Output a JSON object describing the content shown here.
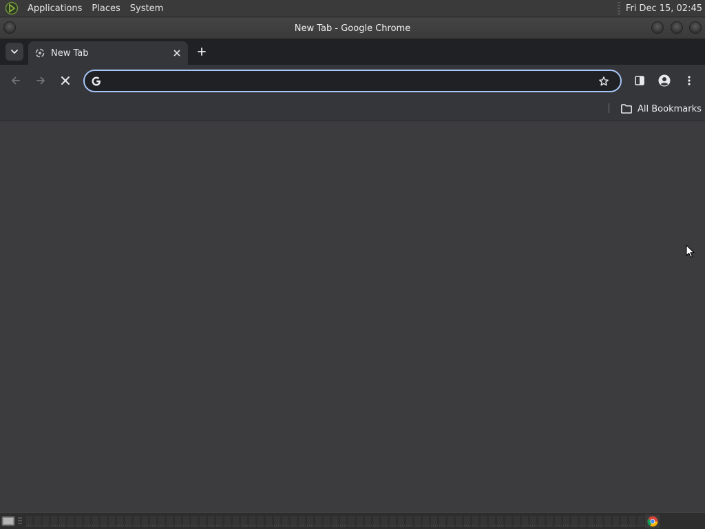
{
  "top_panel": {
    "menus": [
      "Applications",
      "Places",
      "System"
    ],
    "clock": "Fri Dec 15, 02:45"
  },
  "window": {
    "title": "New Tab - Google Chrome"
  },
  "tabs": [
    {
      "label": "New Tab",
      "active": true
    }
  ],
  "toolbar": {
    "omnibox_value": "",
    "omnibox_placeholder": ""
  },
  "bookmarks_bar": {
    "all_bookmarks_label": "All Bookmarks"
  },
  "colors": {
    "accent": "#a8c7fa",
    "toolbar": "#35363a",
    "tabstrip": "#202124",
    "content": "#3c3c3f"
  }
}
